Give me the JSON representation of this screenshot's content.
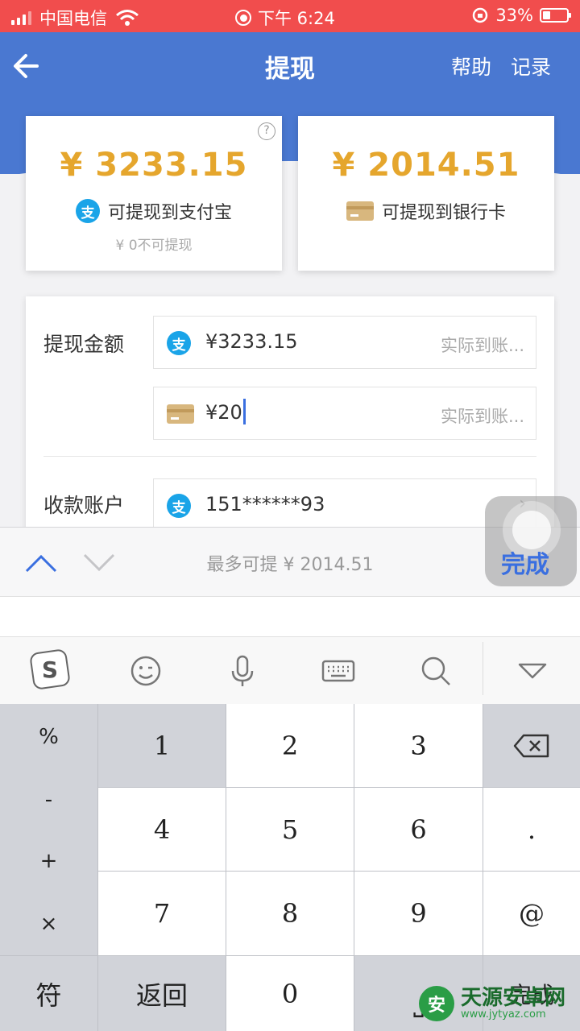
{
  "status_bar": {
    "carrier": "中国电信",
    "time": "下午 6:24",
    "battery": "33%"
  },
  "nav": {
    "title": "提现",
    "help": "帮助",
    "record": "记录"
  },
  "balances": {
    "alipay": {
      "amount": "¥ 3233.15",
      "label": "可提现到支付宝",
      "sub": "¥ 0不可提现",
      "help_icon": "?"
    },
    "bank": {
      "amount": "¥ 2014.51",
      "label": "可提现到银行卡"
    }
  },
  "form": {
    "amount_label": "提现金额",
    "alipay_value": "¥3233.15",
    "alipay_hint": "实际到账...",
    "bank_value": "¥20",
    "bank_hint": "实际到账...",
    "account_label": "收款账户",
    "account_value": "151******93",
    "account_arrow": "›",
    "alipay_icon_char": "支"
  },
  "keyboard_toolbar": {
    "hint": "最多可提 ¥  2014.51",
    "done": "完成"
  },
  "keyboard": {
    "symbols": [
      "%",
      "-",
      "+",
      "×"
    ],
    "digits": [
      "1",
      "2",
      "3",
      "4",
      "5",
      "6",
      "7",
      "8",
      "9",
      "0"
    ],
    "dot": ".",
    "at": "@",
    "symbol_key": "符",
    "back_key": "返回",
    "space_key": "⎵",
    "done_key": "完成"
  },
  "watermark": {
    "logo": "安",
    "title": "天源安卓网",
    "url": "www.jytyaz.com"
  },
  "colors": {
    "status_bar": "#f14d4d",
    "header": "#4a78d1",
    "amount": "#e5a62d",
    "accent": "#3a6fe0",
    "alipay": "#1aa4e8"
  }
}
